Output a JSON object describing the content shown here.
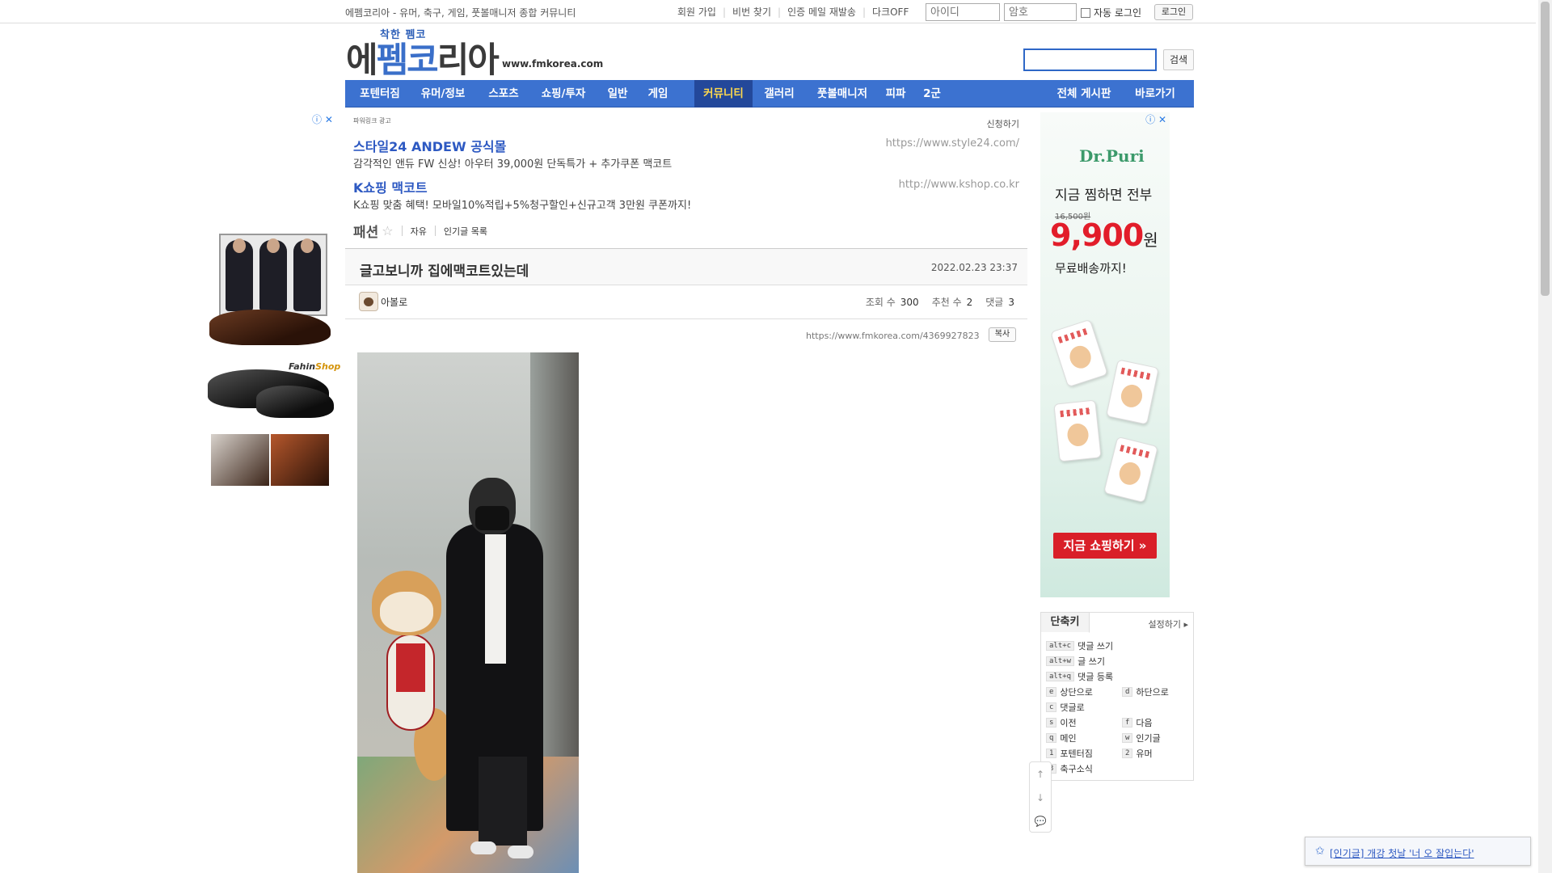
{
  "topbar": {
    "tagline": "에펨코리아 - 유머, 축구, 게임, 풋볼매니저 종합 커뮤니티",
    "links": [
      "회원 가입",
      "비번 찾기",
      "인증 메일 재발송",
      "다크OFF"
    ],
    "id_placeholder": "아이디",
    "pw_placeholder": "암호",
    "autologin_label": "자동 로그인",
    "login_button": "로그인"
  },
  "header": {
    "logo_small": "착한 펨코",
    "logo_main_a": "에",
    "logo_main_b": "펨코",
    "logo_main_c": "리아",
    "url": "www.fmkorea.com",
    "search_button": "검색"
  },
  "nav": {
    "items": [
      "포텐터짐",
      "유머/정보",
      "스포츠",
      "쇼핑/투자",
      "일반",
      "게임",
      "커뮤니티",
      "갤러리",
      "풋볼매니저",
      "피파",
      "2군"
    ],
    "active": "커뮤니티",
    "right_items": [
      "전체 게시판",
      "바로가기"
    ]
  },
  "left_ad": {
    "close_label": "ⓘ ✕",
    "brand_a": "Fahin",
    "brand_b": "Shop"
  },
  "text_ads": {
    "powerlink": "파워링크 광고",
    "apply": "신청하기",
    "items": [
      {
        "title": "스타일24 ANDEW 공식몰",
        "desc": "감각적인 앤듀 FW 신상! 아우터 39,000원 단독특가 + 추가쿠폰 맥코트",
        "url": "https://www.style24.com/"
      },
      {
        "title": "K쇼핑 맥코트",
        "desc": "K쇼핑 맞춤 혜택! 모바일10%적립+5%청구할인+신규고객 3만원 쿠폰까지!",
        "url": "http://www.kshop.co.kr"
      }
    ]
  },
  "board": {
    "title": "패션",
    "star": "☆",
    "tags": [
      "자유",
      "인기글 목록"
    ]
  },
  "post": {
    "title": "글고보니까 집에맥코트있는데",
    "date": "2022.02.23 23:37",
    "author": "아볼로",
    "views_label": "조회 수",
    "views": "300",
    "recommend_label": "추천 수",
    "recommend": "2",
    "comments_label": "댓글",
    "comments": "3",
    "url": "https://www.fmkorea.com/4369927823",
    "copy_button": "복사"
  },
  "right_ad": {
    "ctrl": "ⓘ ✕",
    "brand": "Dr.Puri",
    "headline": "지금 찜하면 전부",
    "orig_price": "16,500원",
    "price": "9,900",
    "won": "원",
    "shipping": "무료배송까지!",
    "cta": "지금 쇼핑하기 »"
  },
  "shortcut": {
    "tab": "단축키",
    "setting": "설정하기 ▸",
    "items": [
      {
        "key": "alt+c",
        "label": "댓글 쓰기"
      },
      {
        "key": "alt+w",
        "label": "글 쓰기"
      },
      {
        "key": "alt+q",
        "label": "댓글 등록"
      },
      {
        "key": "e",
        "label": "상단으로"
      },
      {
        "key": "d",
        "label": "하단으로"
      },
      {
        "key": "c",
        "label": "댓글로"
      },
      {
        "key": "s",
        "label": "이전"
      },
      {
        "key": "f",
        "label": "다음"
      },
      {
        "key": "q",
        "label": "메인"
      },
      {
        "key": "w",
        "label": "인기글"
      },
      {
        "key": "1",
        "label": "포텐터짐"
      },
      {
        "key": "2",
        "label": "유머"
      },
      {
        "key": "3",
        "label": "축구소식"
      }
    ]
  },
  "float_buttons": [
    "↑",
    "↓",
    "💬"
  ],
  "toast": {
    "icon": "✩",
    "text": "[인기글] 개강 첫날 '너 오 잘입는다'"
  }
}
